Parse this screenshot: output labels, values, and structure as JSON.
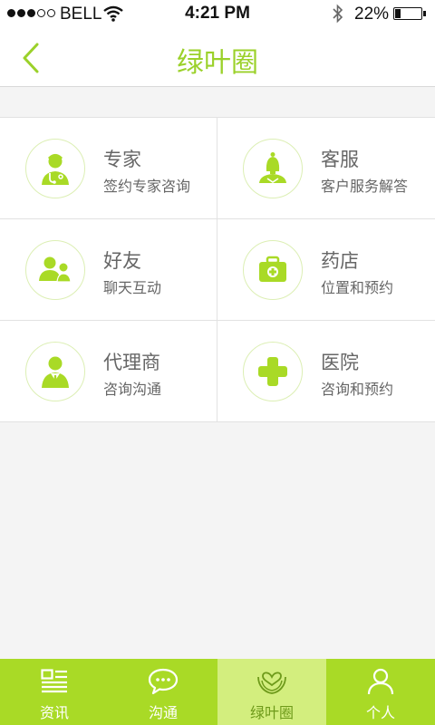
{
  "status_bar": {
    "carrier": "BELL",
    "time": "4:21 PM",
    "battery_percent": "22%",
    "battery_level": 0.22,
    "signal_filled": 3,
    "signal_total": 5
  },
  "nav": {
    "title": "绿叶圈",
    "back_icon": "chevron-left-icon"
  },
  "grid": {
    "items": [
      {
        "title": "专家",
        "subtitle": "签约专家咨询",
        "icon": "doctor-icon"
      },
      {
        "title": "客服",
        "subtitle": "客户服务解答",
        "icon": "customer-service-icon"
      },
      {
        "title": "好友",
        "subtitle": "聊天互动",
        "icon": "friends-icon"
      },
      {
        "title": "药店",
        "subtitle": "位置和预约",
        "icon": "medical-kit-icon"
      },
      {
        "title": "代理商",
        "subtitle": "咨询沟通",
        "icon": "agent-icon"
      },
      {
        "title": "医院",
        "subtitle": "咨询和预约",
        "icon": "hospital-cross-icon"
      }
    ]
  },
  "tab_bar": {
    "tabs": [
      {
        "label": "资讯",
        "icon": "news-icon",
        "active": false
      },
      {
        "label": "沟通",
        "icon": "chat-bubble-icon",
        "active": false
      },
      {
        "label": "绿叶圈",
        "icon": "leaf-circle-icon",
        "active": true
      },
      {
        "label": "个人",
        "icon": "person-icon",
        "active": false
      }
    ]
  },
  "colors": {
    "accent": "#9bd12a",
    "tab_bar": "#a9da26",
    "tab_active": "#d3ee7e",
    "background": "#f4f4f4"
  }
}
